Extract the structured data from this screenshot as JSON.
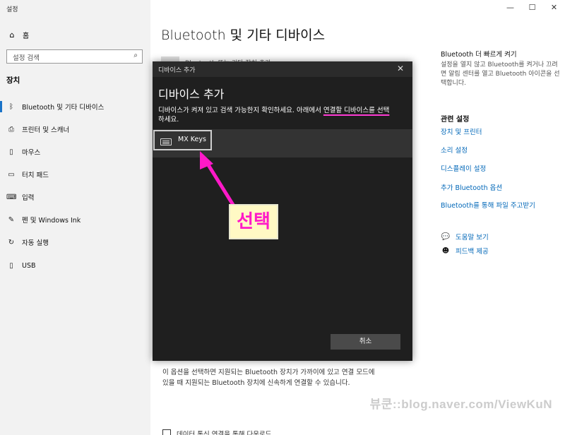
{
  "app": {
    "title": "설정"
  },
  "window_controls": {
    "minimize": "—",
    "maximize": "☐",
    "close": "✕"
  },
  "sidebar": {
    "home": "홈",
    "search_placeholder": "설정 검색",
    "section_title": "장치",
    "items": [
      {
        "label": "Bluetooth 및 기타 디바이스",
        "icon": "bluetooth-icon",
        "active": true
      },
      {
        "label": "프린터 및 스캐너",
        "icon": "printer-icon"
      },
      {
        "label": "마우스",
        "icon": "mouse-icon"
      },
      {
        "label": "터치 패드",
        "icon": "touchpad-icon"
      },
      {
        "label": "입력",
        "icon": "keyboard-icon"
      },
      {
        "label": "펜 및 Windows Ink",
        "icon": "pen-icon"
      },
      {
        "label": "자동 실행",
        "icon": "autoplay-icon"
      },
      {
        "label": "USB",
        "icon": "usb-icon"
      }
    ]
  },
  "main": {
    "title": "Bluetooth 및 기타 디바이스",
    "add_label": "Bluetooth 또는 기타 장치 추가",
    "description": "이 옵션을 선택하면 지원되는 Bluetooth 장치가 가까이에 있고 연결 모드에 있을 때 지원되는 Bluetooth 장치에 신속하게 연결할 수 있습니다.",
    "bottom_option": "데이터 통신 연결을 통해 다운로드"
  },
  "right": {
    "faster_title": "Bluetooth 더 빠르게 켜기",
    "faster_desc": "설정을 열지 않고 Bluetooth를 켜거나 끄려면 알림 센터를 열고 Bluetooth 아이콘을 선택합니다.",
    "related_title": "관련 설정",
    "links": [
      "장치 및 프린터",
      "소리 설정",
      "디스플레이 설정",
      "추가 Bluetooth 옵션",
      "Bluetooth를 통해 파일 주고받기"
    ],
    "help": "도움말 보기",
    "feedback": "피드백 제공"
  },
  "dialog": {
    "bar_title": "디바이스 추가",
    "heading": "디바이스 추가",
    "instruction_pre": "디바이스가 켜져 있고 검색 가능한지 확인하세요. 아래에서 ",
    "instruction_highlight": "연결할 디바이스를 선택",
    "instruction_post": "하세요.",
    "device_name": "MX Keys",
    "cancel_label": "취소"
  },
  "annotation": {
    "label": "선택",
    "color": "#ff19c8"
  },
  "watermark": "뷰쿤::blog.naver.com/ViewKuN"
}
